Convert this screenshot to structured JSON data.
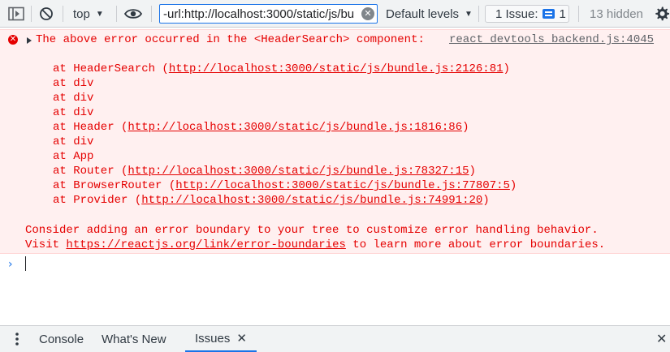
{
  "toolbar": {
    "context_label": "top",
    "filter_value": "-url:http://localhost:3000/static/js/bu",
    "levels_label": "Default levels",
    "issues_label": "1 Issue:",
    "issues_count": "1",
    "hidden_label": "13 hidden"
  },
  "error": {
    "header": "The above error occurred in the <HeaderSearch> component:",
    "source": "react_devtools_backend.js:4045",
    "stack": [
      {
        "prefix": "at HeaderSearch (",
        "link": "http://localhost:3000/static/js/bundle.js:2126:81",
        "suffix": ")"
      },
      {
        "prefix": "at div",
        "link": "",
        "suffix": ""
      },
      {
        "prefix": "at div",
        "link": "",
        "suffix": ""
      },
      {
        "prefix": "at div",
        "link": "",
        "suffix": ""
      },
      {
        "prefix": "at Header (",
        "link": "http://localhost:3000/static/js/bundle.js:1816:86",
        "suffix": ")"
      },
      {
        "prefix": "at div",
        "link": "",
        "suffix": ""
      },
      {
        "prefix": "at App",
        "link": "",
        "suffix": ""
      },
      {
        "prefix": "at Router (",
        "link": "http://localhost:3000/static/js/bundle.js:78327:15",
        "suffix": ")"
      },
      {
        "prefix": "at BrowserRouter (",
        "link": "http://localhost:3000/static/js/bundle.js:77807:5",
        "suffix": ")"
      },
      {
        "prefix": "at Provider (",
        "link": "http://localhost:3000/static/js/bundle.js:74991:20",
        "suffix": ")"
      }
    ],
    "advice_line1": "Consider adding an error boundary to your tree to customize error handling behavior.",
    "advice_line2_prefix": "Visit ",
    "advice_link": "https://reactjs.org/link/error-boundaries",
    "advice_line2_suffix": " to learn more about error boundaries."
  },
  "drawer": {
    "tabs": [
      {
        "label": "Console"
      },
      {
        "label": "What's New"
      },
      {
        "label": "Issues"
      }
    ]
  },
  "colors": {
    "error_text": "#e50000",
    "error_bg": "#fff0f0",
    "accent": "#1a73e8"
  },
  "icons": [
    "sidebar-toggle-icon",
    "clear-console-icon",
    "eye-icon",
    "clear-filter-icon",
    "issue-icon",
    "settings-gear-icon",
    "error-icon",
    "close-drawer-icon"
  ]
}
